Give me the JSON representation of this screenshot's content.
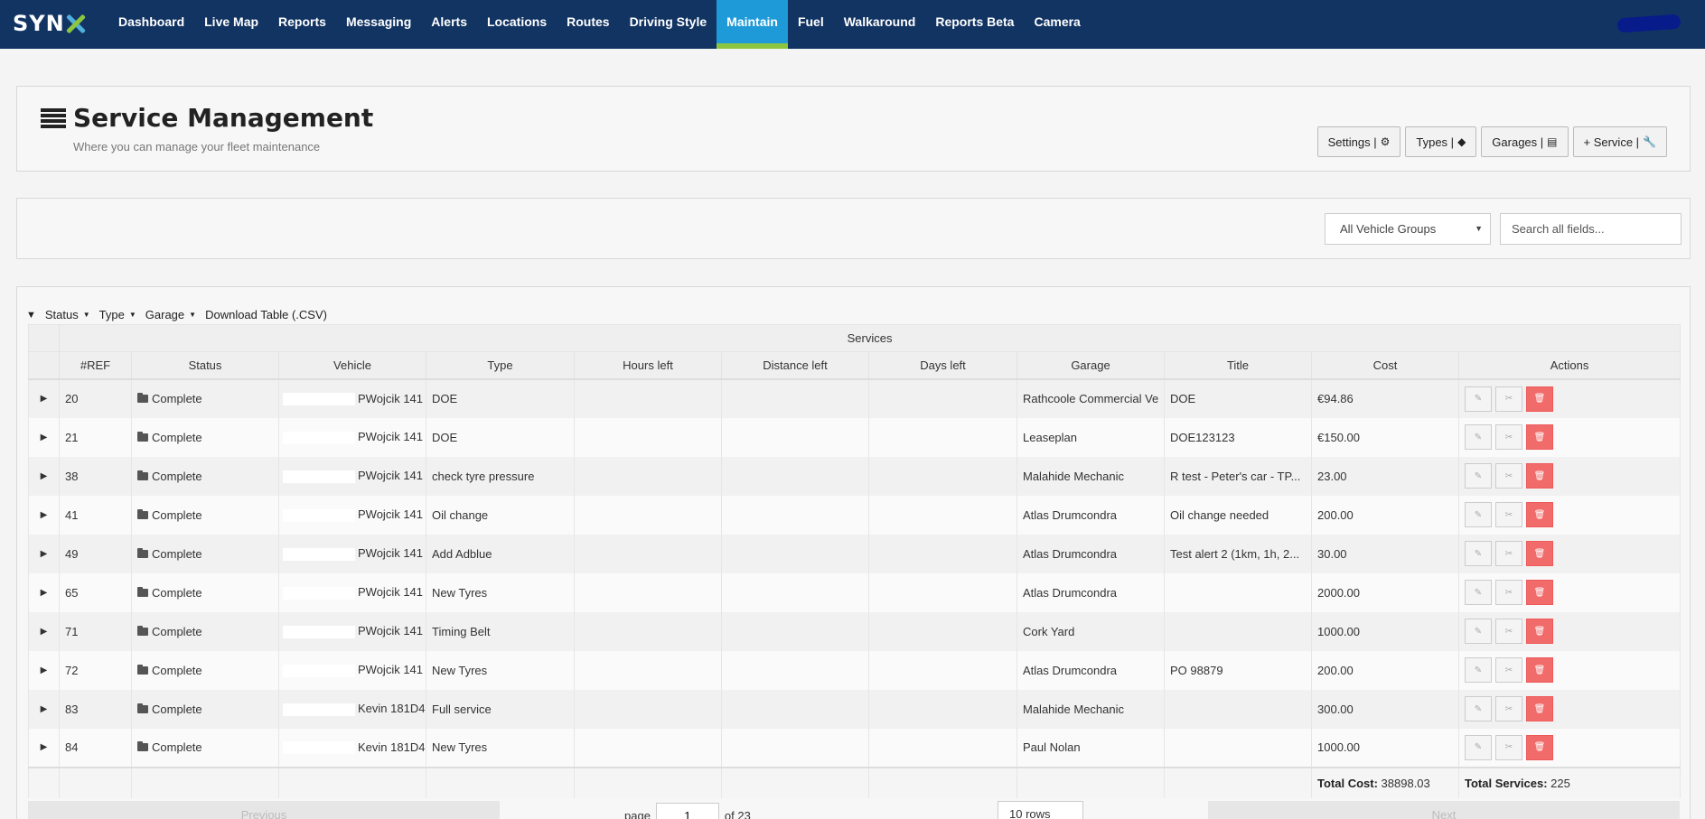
{
  "app": {
    "logo": "SYN",
    "nav": [
      "Dashboard",
      "Live Map",
      "Reports",
      "Messaging",
      "Alerts",
      "Locations",
      "Routes",
      "Driving Style",
      "Maintain",
      "Fuel",
      "Walkaround",
      "Reports Beta",
      "Camera"
    ],
    "active_nav": "Maintain"
  },
  "header": {
    "title": "Service Management",
    "subtitle": "Where you can manage your fleet maintenance",
    "buttons": {
      "settings": "Settings |",
      "types": "Types |",
      "garages": "Garages |",
      "service": "+ Service |"
    }
  },
  "filters": {
    "vehicle_groups": "All Vehicle Groups",
    "search_placeholder": "Search all fields...",
    "status": "Status",
    "type": "Type",
    "garage": "Garage",
    "download": "Download Table (.CSV)"
  },
  "table": {
    "group_header": "Services",
    "columns": [
      "#REF",
      "Status",
      "Vehicle",
      "Type",
      "Hours left",
      "Distance left",
      "Days left",
      "Garage",
      "Title",
      "Cost",
      "Actions"
    ],
    "rows": [
      {
        "ref": "20",
        "status": "Complete",
        "vehicle": "PWojcik 141",
        "type": "DOE",
        "hours": "",
        "distance": "",
        "days": "",
        "garage": "Rathcoole Commercial Ve",
        "title": "DOE",
        "cost": "€94.86"
      },
      {
        "ref": "21",
        "status": "Complete",
        "vehicle": "PWojcik 141",
        "type": "DOE",
        "hours": "",
        "distance": "",
        "days": "",
        "garage": "Leaseplan",
        "title": "DOE123123",
        "cost": "€150.00"
      },
      {
        "ref": "38",
        "status": "Complete",
        "vehicle": "PWojcik 141",
        "type": "check tyre pressure",
        "hours": "",
        "distance": "",
        "days": "",
        "garage": "Malahide Mechanic",
        "title": "R test - Peter's car - TP...",
        "cost": "23.00"
      },
      {
        "ref": "41",
        "status": "Complete",
        "vehicle": "PWojcik 141",
        "type": "Oil change",
        "hours": "",
        "distance": "",
        "days": "",
        "garage": "Atlas Drumcondra",
        "title": "Oil change needed",
        "cost": "200.00"
      },
      {
        "ref": "49",
        "status": "Complete",
        "vehicle": "PWojcik 141",
        "type": "Add Adblue",
        "hours": "",
        "distance": "",
        "days": "",
        "garage": "Atlas Drumcondra",
        "title": "Test alert 2 (1km, 1h, 2...",
        "cost": "30.00"
      },
      {
        "ref": "65",
        "status": "Complete",
        "vehicle": "PWojcik 141",
        "type": "New Tyres",
        "hours": "",
        "distance": "",
        "days": "",
        "garage": "Atlas Drumcondra",
        "title": "",
        "cost": "2000.00"
      },
      {
        "ref": "71",
        "status": "Complete",
        "vehicle": "PWojcik 141",
        "type": "Timing Belt",
        "hours": "",
        "distance": "",
        "days": "",
        "garage": "Cork Yard",
        "title": "",
        "cost": "1000.00"
      },
      {
        "ref": "72",
        "status": "Complete",
        "vehicle": "PWojcik 141",
        "type": "New Tyres",
        "hours": "",
        "distance": "",
        "days": "",
        "garage": "Atlas Drumcondra",
        "title": "PO 98879",
        "cost": "200.00"
      },
      {
        "ref": "83",
        "status": "Complete",
        "vehicle": "Kevin 181D4",
        "type": "Full service",
        "hours": "",
        "distance": "",
        "days": "",
        "garage": "Malahide Mechanic",
        "title": "",
        "cost": "300.00"
      },
      {
        "ref": "84",
        "status": "Complete",
        "vehicle": "Kevin 181D4",
        "type": "New Tyres",
        "hours": "",
        "distance": "",
        "days": "",
        "garage": "Paul Nolan",
        "title": "",
        "cost": "1000.00"
      }
    ],
    "footer": {
      "total_cost_label": "Total Cost:",
      "total_cost_value": "38898.03",
      "total_services_label": "Total Services:",
      "total_services_value": "225"
    }
  },
  "pager": {
    "previous": "Previous",
    "page_label": "page",
    "page": "1",
    "of": "of 23",
    "rows": "10 rows",
    "next": "Next"
  },
  "icons": {
    "settings": "gear-icon",
    "types": "tags-icon",
    "garages": "clipboard-icon",
    "service": "wrench-icon",
    "row_expand": "caret-right-icon",
    "status": "folder-icon",
    "edit": "edit-icon",
    "attach": "paperclip-icon",
    "delete": "trash-icon"
  },
  "colors": {
    "nav_bg": "#123463",
    "nav_active": "#1e9ad8",
    "nav_active_underline": "#8cc63f",
    "delete_button": "#f26b6b"
  }
}
